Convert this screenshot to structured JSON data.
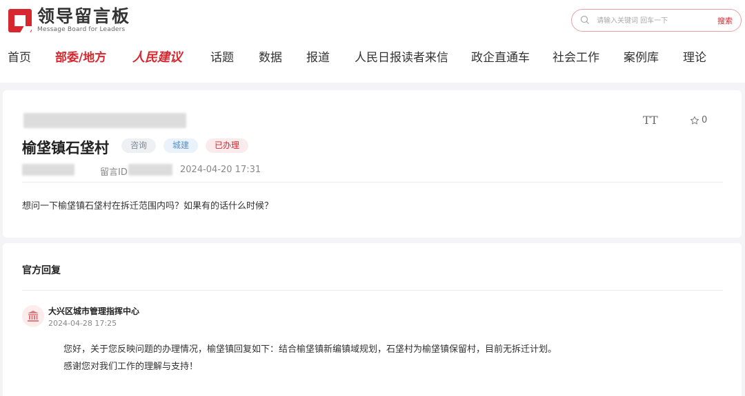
{
  "header": {
    "logo_title": "领导留言板",
    "logo_subtitle": "Message Board for Leaders",
    "search_placeholder": "请输入关键词 回车一下",
    "search_button": "搜索"
  },
  "nav": {
    "items": [
      {
        "label": "首页"
      },
      {
        "label": "部委/地方"
      },
      {
        "label": "人民建议"
      },
      {
        "label": "话题"
      },
      {
        "label": "数据"
      },
      {
        "label": "报道"
      },
      {
        "label": "人民日报读者来信"
      },
      {
        "label": "政企直通车"
      },
      {
        "label": "社会工作"
      },
      {
        "label": "案例库"
      },
      {
        "label": "理论"
      }
    ]
  },
  "message": {
    "title": "榆垡镇石垡村",
    "tags": [
      "咨询",
      "城建",
      "已办理"
    ],
    "id_label": "留言ID",
    "date": "2024-04-20 17:31",
    "body": "想问一下榆垡镇石垡村在拆迁范围内吗？如果有的话什么时候？",
    "font_size_label": "TT",
    "favorite_count": "0"
  },
  "reply": {
    "heading": "官方回复",
    "org": "大兴区城市管理指挥中心",
    "date": "2024-04-28 17:25",
    "line1": "您好，关于您反映问题的办理情况，榆垡镇回复如下：结合榆垡镇新编镇域规划，石垡村为榆垡镇保留村，目前无拆迁计划。",
    "line2": "感谢您对我们工作的理解与支持！"
  },
  "colors": {
    "brand_red": "#d7282f"
  }
}
